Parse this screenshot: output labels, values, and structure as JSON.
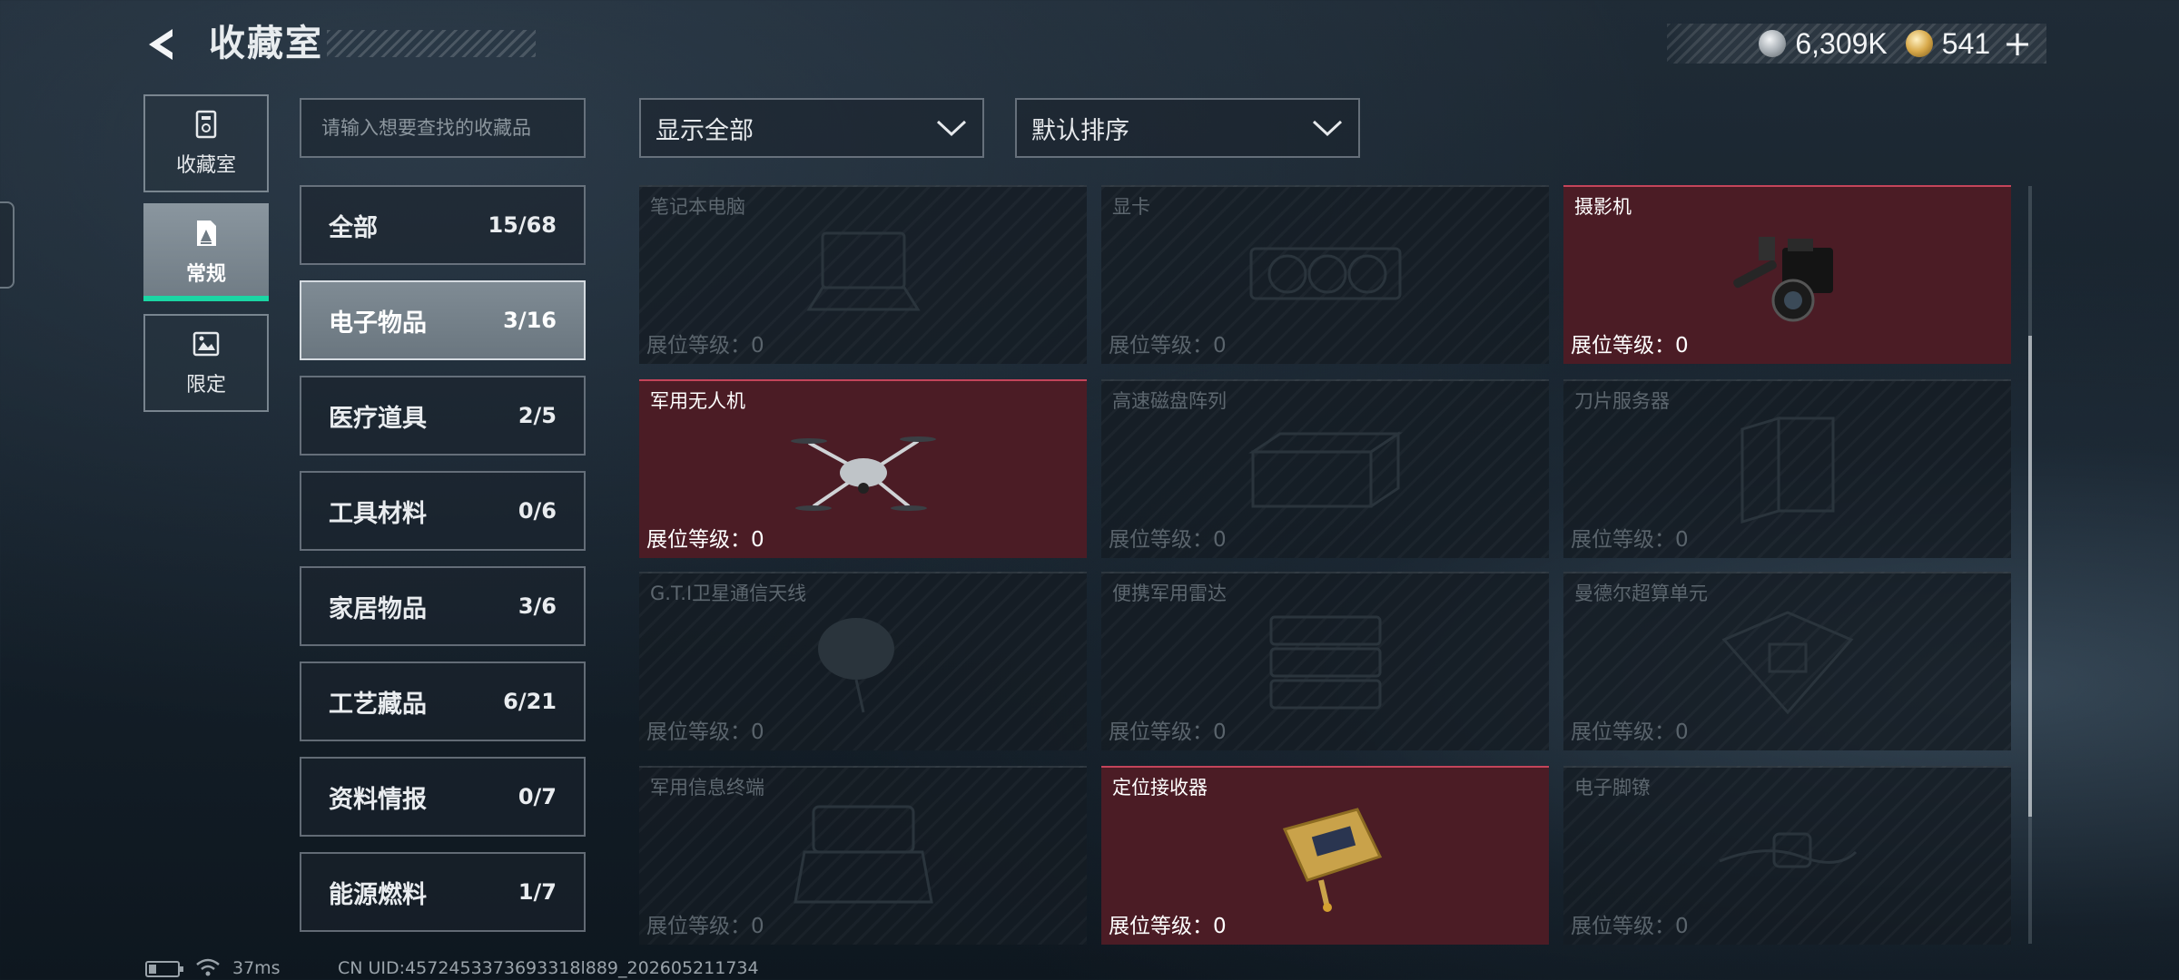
{
  "header": {
    "title": "收藏室",
    "currency_silver": "6,309K",
    "currency_gold": "541",
    "plus_label": "+"
  },
  "side_nav": [
    {
      "label": "收藏室",
      "icon": "trophy-cabinet-icon"
    },
    {
      "label": "常规",
      "icon": "regular-collection-icon"
    },
    {
      "label": "限定",
      "icon": "limited-collection-icon"
    }
  ],
  "search": {
    "placeholder": "请输入想要查找的收藏品"
  },
  "categories": [
    {
      "name": "全部",
      "count": "15/68"
    },
    {
      "name": "电子物品",
      "count": "3/16"
    },
    {
      "name": "医疗道具",
      "count": "2/5"
    },
    {
      "name": "工具材料",
      "count": "0/6"
    },
    {
      "name": "家居物品",
      "count": "3/6"
    },
    {
      "name": "工艺藏品",
      "count": "6/21"
    },
    {
      "name": "资料情报",
      "count": "0/7"
    },
    {
      "name": "能源燃料",
      "count": "1/7"
    }
  ],
  "filters": {
    "display": "显示全部",
    "sort": "默认排序"
  },
  "items": [
    {
      "name": "笔记本电脑",
      "level": "展位等级：0",
      "owned": false
    },
    {
      "name": "显卡",
      "level": "展位等级：0",
      "owned": false
    },
    {
      "name": "摄影机",
      "level": "展位等级：0",
      "owned": true
    },
    {
      "name": "军用无人机",
      "level": "展位等级：0",
      "owned": true
    },
    {
      "name": "高速磁盘阵列",
      "level": "展位等级：0",
      "owned": false
    },
    {
      "name": "刀片服务器",
      "level": "展位等级：0",
      "owned": false
    },
    {
      "name": "G.T.I卫星通信天线",
      "level": "展位等级：0",
      "owned": false
    },
    {
      "name": "便携军用雷达",
      "level": "展位等级：0",
      "owned": false
    },
    {
      "name": "曼德尔超算单元",
      "level": "展位等级：0",
      "owned": false
    },
    {
      "name": "军用信息终端",
      "level": "展位等级：0",
      "owned": false
    },
    {
      "name": "定位接收器",
      "level": "展位等级：0",
      "owned": true
    },
    {
      "name": "电子脚镣",
      "level": "展位等级：0",
      "owned": false
    }
  ],
  "footer": {
    "ping": "37ms",
    "uid": "CN UID:4572453373693318l889_202605211734"
  },
  "colors": {
    "accent": "#1bd6a4",
    "owned_card": "#4b1c25",
    "owned_border": "#c4445a"
  }
}
